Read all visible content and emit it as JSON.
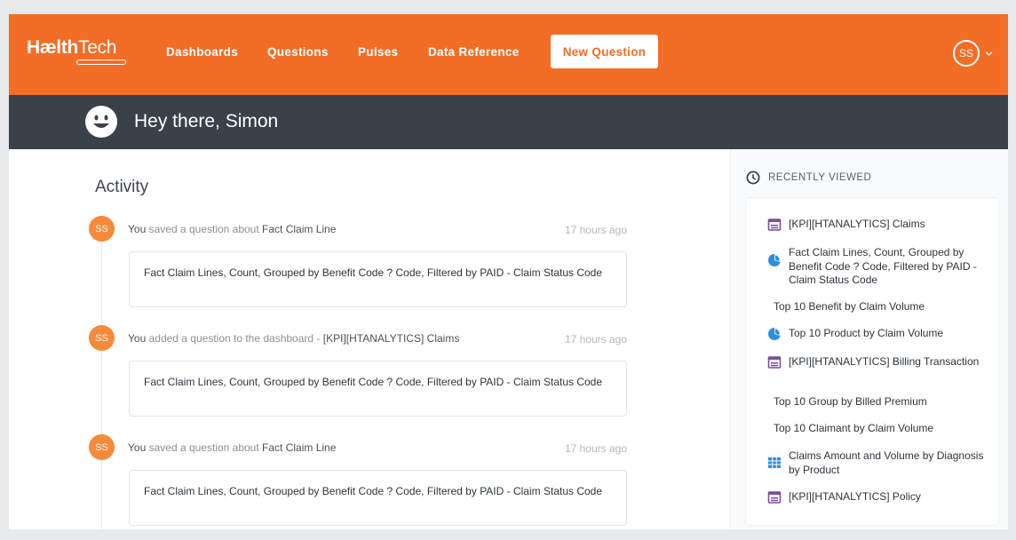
{
  "nav": {
    "logo_bold": "Hælth",
    "logo_light": "Tech",
    "links": [
      "Dashboards",
      "Questions",
      "Pulses",
      "Data Reference"
    ],
    "new_question": "New Question",
    "user_initials": "SS"
  },
  "greeting": "Hey there, Simon",
  "activity": {
    "title": "Activity",
    "items": [
      {
        "avatar": "SS",
        "actor": "You",
        "verb": "saved a question about",
        "target": "Fact Claim Line",
        "time": "17 hours ago",
        "card": "Fact Claim Lines, Count, Grouped by Benefit Code ? Code, Filtered by PAID - Claim Status Code"
      },
      {
        "avatar": "SS",
        "actor": "You",
        "verb": "added a question to the dashboard -",
        "target": "[KPI][HTANALYTICS] Claims",
        "time": "17 hours ago",
        "card": "Fact Claim Lines, Count, Grouped by Benefit Code ? Code, Filtered by PAID - Claim Status Code"
      },
      {
        "avatar": "SS",
        "actor": "You",
        "verb": "saved a question about",
        "target": "Fact Claim Line",
        "time": "17 hours ago",
        "card": "Fact Claim Lines, Count, Grouped by Benefit Code ? Code, Filtered by PAID - Claim Status Code"
      }
    ]
  },
  "recently_viewed": {
    "heading": "RECENTLY VIEWED",
    "items": [
      {
        "label": "[KPI][HTANALYTICS] Claims",
        "icon": "dashboard-icon"
      },
      {
        "label": "Fact Claim Lines, Count, Grouped by Benefit Code ? Code, Filtered by PAID - Claim Status Code",
        "icon": "pie-chart-icon"
      },
      {
        "label": "Top 10 Benefit by Claim Volume",
        "icon": "none"
      },
      {
        "label": "Top 10 Product by Claim Volume",
        "icon": "pie-chart-icon"
      },
      {
        "label": "[KPI][HTANALYTICS] Billing Transaction",
        "icon": "dashboard-icon"
      },
      {
        "label": "Top 10 Group by Billed Premium",
        "icon": "none"
      },
      {
        "label": "Top 10 Claimant by Claim Volume",
        "icon": "none"
      },
      {
        "label": "Claims Amount and Volume by Diagnosis by Product",
        "icon": "table-icon"
      },
      {
        "label": "[KPI][HTANALYTICS] Policy",
        "icon": "dashboard-icon"
      }
    ]
  },
  "colors": {
    "brand_orange": "#f26d26",
    "greeting_bar": "#3b4148",
    "avatar_orange": "#f58a3a",
    "dashboard_icon": "#7b4da0",
    "pie_icon": "#2d8fdd"
  }
}
